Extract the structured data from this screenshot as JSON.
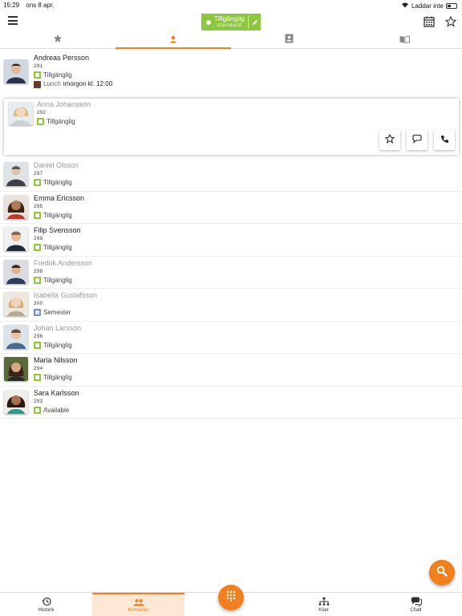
{
  "status_bar": {
    "time": "15:29",
    "date": "ons 8 apr.",
    "charging": "Laddar inte"
  },
  "header": {
    "presence_label": "Tillgänglig",
    "presence_profile": "standard",
    "presence_color": "#8dc63f"
  },
  "tabs": [
    {
      "name": "favorites",
      "icon": "star-icon"
    },
    {
      "name": "contacts",
      "icon": "person-icon",
      "active": true
    },
    {
      "name": "address-book",
      "icon": "contact-card-icon"
    },
    {
      "name": "directory",
      "icon": "book-icon"
    }
  ],
  "contacts": [
    {
      "name": "Andreas Persson",
      "ext": "291",
      "status": "Tillgänglig",
      "lunch_label": "Lunch",
      "lunch_text": "imorgon kl. 12:00"
    },
    {
      "name": "Anna Johansson",
      "ext": "292",
      "status": "Tillgänglig"
    },
    {
      "name": "Daniel  Olsson",
      "ext": "297",
      "status": "Tillgänglig"
    },
    {
      "name": "Emma Ericsson",
      "ext": "295",
      "status": "Tillgänglig"
    },
    {
      "name": "Filip Svensson",
      "ext": "299",
      "status": "Tillgänglig"
    },
    {
      "name": "Fredrik Andersson",
      "ext": "298",
      "status": "Tillgänglig"
    },
    {
      "name": "Isabella Gustafsson",
      "ext": "300",
      "status": "Semester"
    },
    {
      "name": "Johan Larsson",
      "ext": "296",
      "status": "Tillgänglig"
    },
    {
      "name": "Maria Nilsson",
      "ext": "294",
      "status": "Tillgänglig"
    },
    {
      "name": "Sara  Karlsson",
      "ext": "293",
      "status": "Available"
    }
  ],
  "bottom_nav": {
    "history": "Historik",
    "contacts": "Kontakter",
    "queues": "Köer",
    "chat": "Chatt"
  },
  "colors": {
    "accent": "#f07f1d",
    "available": "#8dc63f",
    "vacation": "#7b8fc7"
  }
}
